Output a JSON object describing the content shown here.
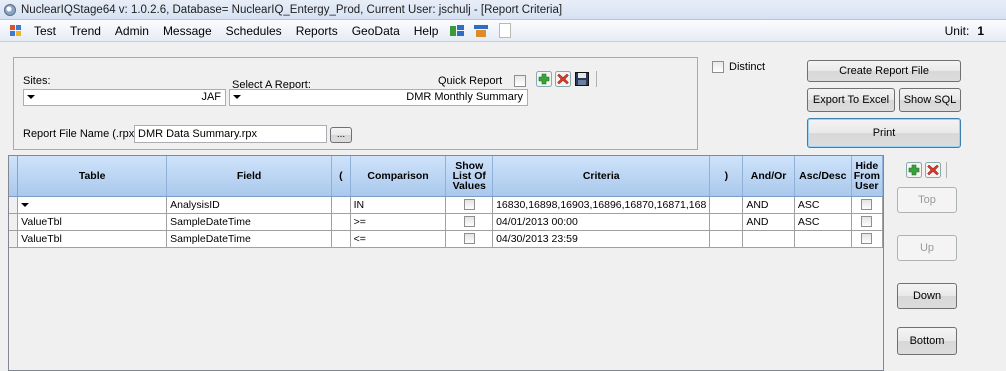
{
  "window": {
    "title": "NuclearIQStage64 v: 1.0.2.6, Database= NuclearIQ_Entergy_Prod, Current User: jschulj - [Report Criteria]"
  },
  "menu": {
    "items": [
      "Test",
      "Trend",
      "Admin",
      "Message",
      "Schedules",
      "Reports",
      "GeoData",
      "Help"
    ],
    "unit_label": "Unit:",
    "unit_value": "1"
  },
  "criteria_panel": {
    "sites_label": "Sites:",
    "sites_value": "JAF",
    "report_label": "Select A Report:",
    "report_value": "DMR Monthly Summary",
    "quick_report_label": "Quick Report",
    "file_name_label": "Report File Name (.rpx)",
    "file_name_value": "DMR Data Summary.rpx",
    "browse_label": "..."
  },
  "options": {
    "distinct_label": "Distinct",
    "create_report_label": "Create Report File",
    "export_excel_label": "Export To Excel",
    "show_sql_label": "Show SQL",
    "print_label": "Print"
  },
  "grid": {
    "headers": [
      "Table",
      "Field",
      "(",
      "Comparison",
      "Show List Of Values",
      "Criteria",
      ")",
      "And/Or",
      "Asc/Desc",
      "Hide From User"
    ],
    "rows": [
      {
        "table": "",
        "field": "AnalysisID",
        "open": "",
        "comparison": "IN",
        "criteria": "16830,16898,16903,16896,16870,16871,168",
        "close": "",
        "andor": "AND",
        "ascdesc": "ASC"
      },
      {
        "table": "ValueTbl",
        "field": "SampleDateTime",
        "open": "",
        "comparison": ">=",
        "criteria": "04/01/2013 00:00",
        "close": "",
        "andor": "AND",
        "ascdesc": "ASC"
      },
      {
        "table": "ValueTbl",
        "field": "SampleDateTime",
        "open": "",
        "comparison": "<=",
        "criteria": "04/30/2013 23:59",
        "close": "",
        "andor": "",
        "ascdesc": ""
      }
    ]
  },
  "side_buttons": {
    "top": "Top",
    "up": "Up",
    "down": "Down",
    "bottom": "Bottom"
  },
  "colors": {
    "add_green": "#3aa23a",
    "delete_red": "#d23b2b",
    "header_blue": "#b9d4f3"
  }
}
